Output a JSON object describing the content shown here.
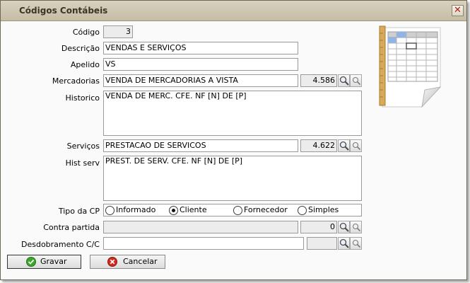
{
  "window": {
    "title": "Códigos Contábeis",
    "close_icon": "close-icon"
  },
  "form": {
    "codigo": {
      "label": "Código",
      "value": "3"
    },
    "descricao": {
      "label": "Descrição",
      "value": "VENDAS E SERVIÇOS"
    },
    "apelido": {
      "label": "Apelido",
      "value": "VS"
    },
    "mercadorias": {
      "label": "Mercadorias",
      "value": "VENDA DE MERCADORIAS A VISTA",
      "code": "4.586"
    },
    "historico": {
      "label": "Historico",
      "value": "VENDA DE MERC. CFE. NF [N] DE [P]"
    },
    "servicos": {
      "label": "Serviços",
      "value": "PRESTACAO DE SERVICOS",
      "code": "4.622"
    },
    "hist_serv": {
      "label": "Hist serv",
      "value": "PREST. DE SERV. CFE. NF [N] DE [P]"
    },
    "tipo_cp": {
      "label": "Tipo da CP",
      "options": [
        "Informado",
        "Cliente",
        "Fornecedor",
        "Simples"
      ],
      "selected": "Cliente"
    },
    "contra_partida": {
      "label": "Contra partida",
      "value": "",
      "code": "0"
    },
    "desdobramento": {
      "label": "Desdobramento C/C",
      "value": "",
      "code": ""
    }
  },
  "buttons": {
    "gravar": "Gravar",
    "cancelar": "Cancelar"
  },
  "colors": {
    "titlebar": "#cdc6b1",
    "window_bg": "#fafafa",
    "gravar_icon": "#3aa62a",
    "cancelar_icon": "#d22a1e"
  }
}
